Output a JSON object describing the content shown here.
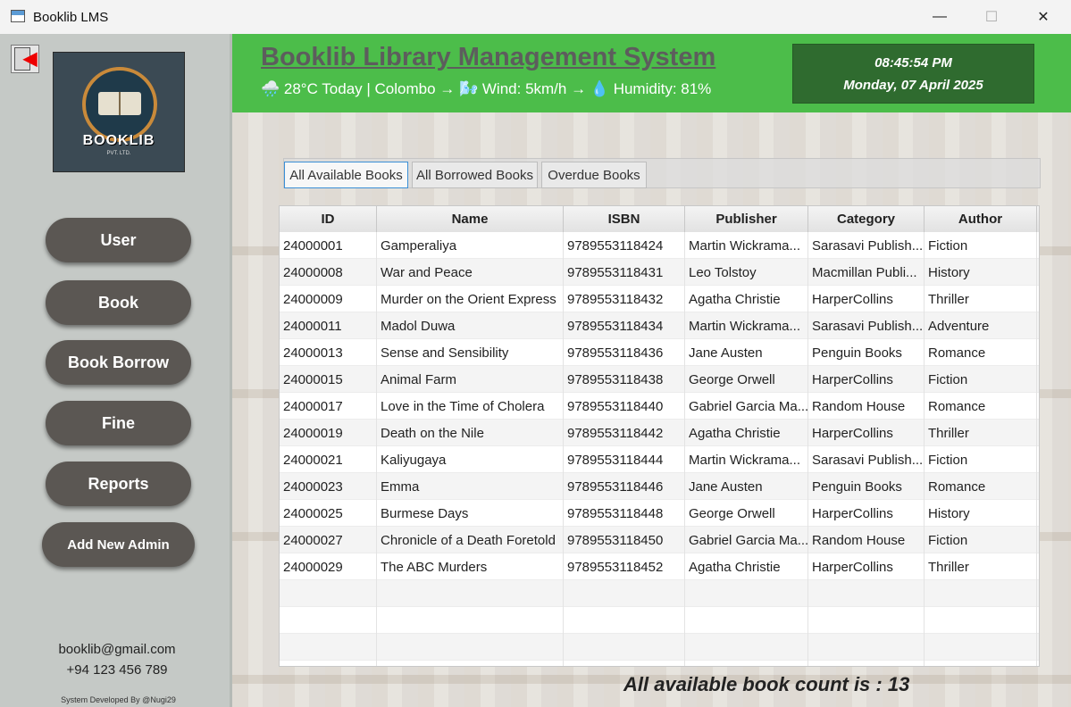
{
  "window": {
    "title": "Booklib LMS",
    "minimize_glyph": "—",
    "maximize_glyph": "☐",
    "close_glyph": "✕"
  },
  "sidebar": {
    "logo_text": "BOOKLIB",
    "logo_subtext": "PVT. LTD.",
    "nav": {
      "user": "User",
      "book": "Book",
      "book_borrow": "Book Borrow",
      "fine": "Fine",
      "reports": "Reports",
      "add_admin": "Add New Admin"
    },
    "email": "booklib@gmail.com",
    "phone": "+94 123 456 789",
    "credit": "System Developed By @Nugi29"
  },
  "header": {
    "title": "Booklib Library Management System",
    "weather": "🌧️ 28°C Today | Colombo → 🌬️ Wind: 5km/h → 💧 Humidity: 81%",
    "time": "08:45:54 PM",
    "date": "Monday, 07 April 2025",
    "color": "#4cbd4a"
  },
  "tabs": {
    "available": "All Available Books",
    "borrowed": "All Borrowed Books",
    "overdue": "Overdue Books",
    "active": "available"
  },
  "table": {
    "columns": {
      "id": "ID",
      "name": "Name",
      "isbn": "ISBN",
      "publisher": "Publisher",
      "category": "Category",
      "author": "Author"
    },
    "rows": [
      {
        "id": "24000001",
        "name": "Gamperaliya",
        "isbn": "9789553118424",
        "publisher": "Martin Wickrama...",
        "category": "Sarasavi Publish...",
        "author": "Fiction"
      },
      {
        "id": "24000008",
        "name": "War and Peace",
        "isbn": "9789553118431",
        "publisher": "Leo Tolstoy",
        "category": "Macmillan Publi...",
        "author": "History"
      },
      {
        "id": "24000009",
        "name": "Murder on the Orient Express",
        "isbn": "9789553118432",
        "publisher": "Agatha Christie",
        "category": "HarperCollins",
        "author": "Thriller"
      },
      {
        "id": "24000011",
        "name": "Madol Duwa",
        "isbn": "9789553118434",
        "publisher": "Martin Wickrama...",
        "category": "Sarasavi Publish...",
        "author": "Adventure"
      },
      {
        "id": "24000013",
        "name": "Sense and Sensibility",
        "isbn": "9789553118436",
        "publisher": "Jane Austen",
        "category": "Penguin Books",
        "author": "Romance"
      },
      {
        "id": "24000015",
        "name": "Animal Farm",
        "isbn": "9789553118438",
        "publisher": "George Orwell",
        "category": "HarperCollins",
        "author": "Fiction"
      },
      {
        "id": "24000017",
        "name": "Love in the Time of Cholera",
        "isbn": "9789553118440",
        "publisher": "Gabriel Garcia Ma...",
        "category": "Random House",
        "author": "Romance"
      },
      {
        "id": "24000019",
        "name": "Death on the Nile",
        "isbn": "9789553118442",
        "publisher": "Agatha Christie",
        "category": "HarperCollins",
        "author": "Thriller"
      },
      {
        "id": "24000021",
        "name": "Kaliyugaya",
        "isbn": "9789553118444",
        "publisher": "Martin Wickrama...",
        "category": "Sarasavi Publish...",
        "author": "Fiction"
      },
      {
        "id": "24000023",
        "name": "Emma",
        "isbn": "9789553118446",
        "publisher": "Jane Austen",
        "category": "Penguin Books",
        "author": "Romance"
      },
      {
        "id": "24000025",
        "name": "Burmese Days",
        "isbn": "9789553118448",
        "publisher": "George Orwell",
        "category": "HarperCollins",
        "author": "History"
      },
      {
        "id": "24000027",
        "name": "Chronicle of a Death Foretold",
        "isbn": "9789553118450",
        "publisher": "Gabriel Garcia Ma...",
        "category": "Random House",
        "author": "Fiction"
      },
      {
        "id": "24000029",
        "name": "The ABC Murders",
        "isbn": "9789553118452",
        "publisher": "Agatha Christie",
        "category": "HarperCollins",
        "author": "Thriller"
      }
    ]
  },
  "footer": {
    "count_label": "All available book count is : 13"
  }
}
